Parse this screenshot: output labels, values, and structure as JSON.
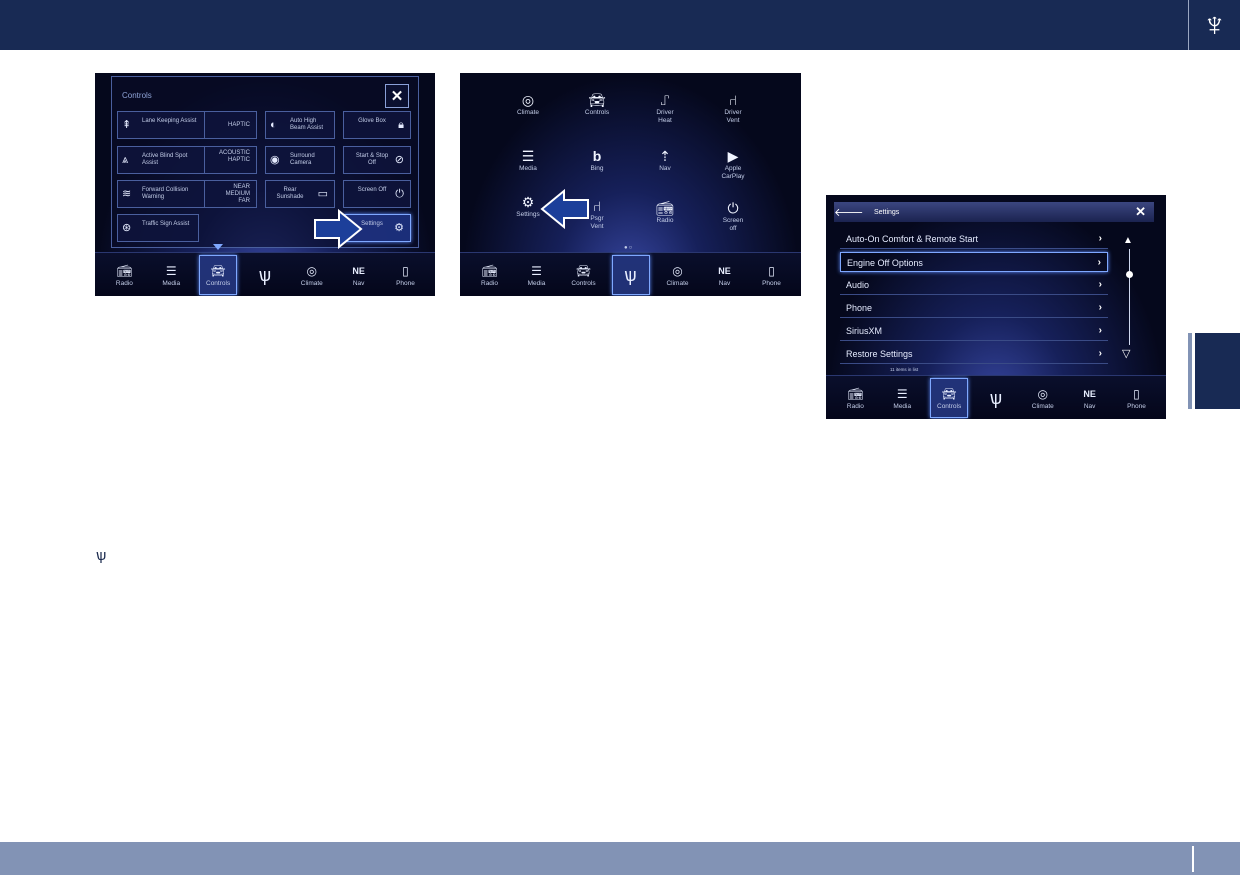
{
  "header": {
    "logo_icon": "trident-logo-icon"
  },
  "footer": {},
  "left_screen": {
    "title": "Controls",
    "close_label": "✕",
    "controls": [
      {
        "icon": "lane-keeping-icon",
        "label": "Lane Keeping Assist",
        "value": "HAPTIC"
      },
      {
        "icon": "high-beam-icon",
        "label": "Auto High Beam Assist",
        "value": ""
      },
      {
        "icon": "lock-icon",
        "label": "Glove Box",
        "value": ""
      },
      {
        "icon": "blind-spot-icon",
        "label": "Active Blind Spot Assist",
        "value": "ACOUSTIC HAPTIC"
      },
      {
        "icon": "camera-icon",
        "label": "Surround Camera",
        "value": ""
      },
      {
        "icon": "start-stop-icon",
        "label": "Start & Stop Off",
        "value": ""
      },
      {
        "icon": "collision-icon",
        "label": "Forward Collision Warning",
        "value": "NEAR MEDIUM FAR"
      },
      {
        "icon": "sunshade-icon",
        "label": "Rear Sunshade",
        "value": ""
      },
      {
        "icon": "power-icon",
        "label": "Screen Off",
        "value": ""
      },
      {
        "icon": "traffic-sign-icon",
        "label": "Traffic Sign Assist",
        "value": ""
      },
      {
        "icon": "gears-icon",
        "label": "Settings",
        "value": ""
      }
    ]
  },
  "middle_screen": {
    "apps": [
      {
        "icon": "climate-icon",
        "label": "Climate"
      },
      {
        "icon": "car-icon",
        "label": "Controls"
      },
      {
        "icon": "seat-heat-icon",
        "label": "Driver\nHeat"
      },
      {
        "icon": "seat-vent-icon",
        "label": "Driver\nVent"
      },
      {
        "icon": "equalizer-icon",
        "label": "Media"
      },
      {
        "icon": "bing-icon",
        "label": "Bing"
      },
      {
        "icon": "nav-icon",
        "label": "Nav"
      },
      {
        "icon": "carplay-icon",
        "label": "Apple\nCarPlay"
      },
      {
        "icon": "gears-icon",
        "label": "Settings"
      },
      {
        "icon": "seat-vent-icon",
        "label": "Psgr\nVent"
      },
      {
        "icon": "radio-icon",
        "label": "Radio"
      },
      {
        "icon": "power-icon",
        "label": "Screen\noff"
      }
    ],
    "page_dots": "●○"
  },
  "right_screen": {
    "title": "Settings",
    "rows": [
      "Auto-On Comfort & Remote Start",
      "Engine Off Options",
      "Audio",
      "Phone",
      "SiriusXM",
      "Restore Settings"
    ],
    "items_count": "11 items in list"
  },
  "dock": {
    "items": [
      {
        "icon": "radio-icon",
        "label": "Radio"
      },
      {
        "icon": "equalizer-icon",
        "label": "Media"
      },
      {
        "icon": "car-icon",
        "label": "Controls"
      },
      {
        "icon": "trident-icon",
        "label": ""
      },
      {
        "icon": "climate-icon",
        "label": "Climate"
      },
      {
        "icon": "compass-icon",
        "label": "Nav",
        "compass": "NE"
      },
      {
        "icon": "phone-icon",
        "label": "Phone"
      }
    ]
  }
}
